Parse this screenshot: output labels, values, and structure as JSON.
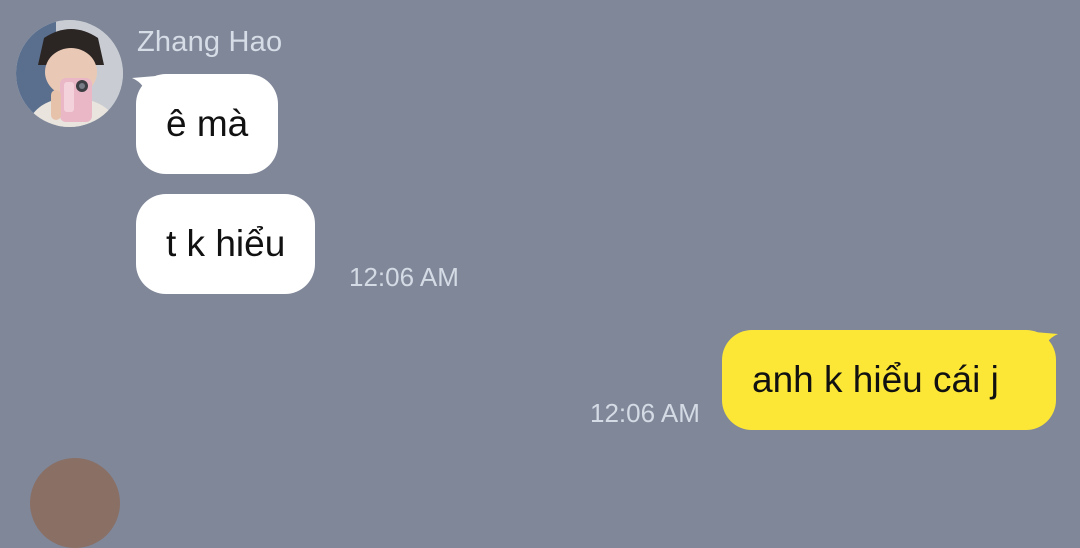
{
  "conversation": {
    "sender": {
      "name": "Zhang Hao",
      "avatar": "user-avatar-photo"
    },
    "messages": [
      {
        "direction": "incoming",
        "text": "ê mà",
        "time": ""
      },
      {
        "direction": "incoming",
        "text": "t k hiểu",
        "time": "12:06 AM"
      },
      {
        "direction": "outgoing",
        "text": "anh k hiểu cái j",
        "time": "12:06 AM"
      }
    ]
  },
  "colors": {
    "background": "#7f8799",
    "incoming_bubble": "#ffffff",
    "outgoing_bubble": "#fde736",
    "meta_text": "#d5dbe5"
  }
}
